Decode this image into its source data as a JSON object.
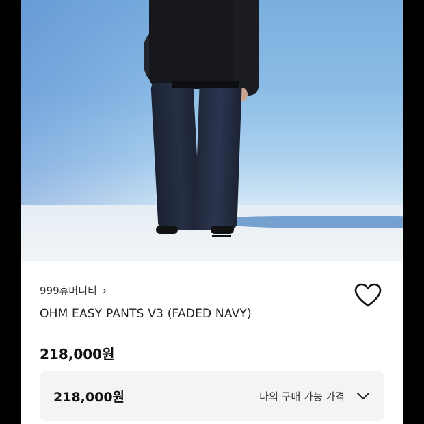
{
  "product": {
    "brand": "999휴머니티",
    "brand_chevron": "›",
    "name": "OHM EASY PANTS V3 (FADED NAVY)",
    "price": "218,000원"
  },
  "price_box": {
    "price": "218,000원",
    "label": "나의 구매 가능 가격"
  },
  "icons": {
    "like": "heart-outline-icon",
    "expand": "chevron-down-icon"
  },
  "colors": {
    "background": "#ffffff",
    "text": "#222222",
    "price_box_bg": "#f4f4f5"
  }
}
